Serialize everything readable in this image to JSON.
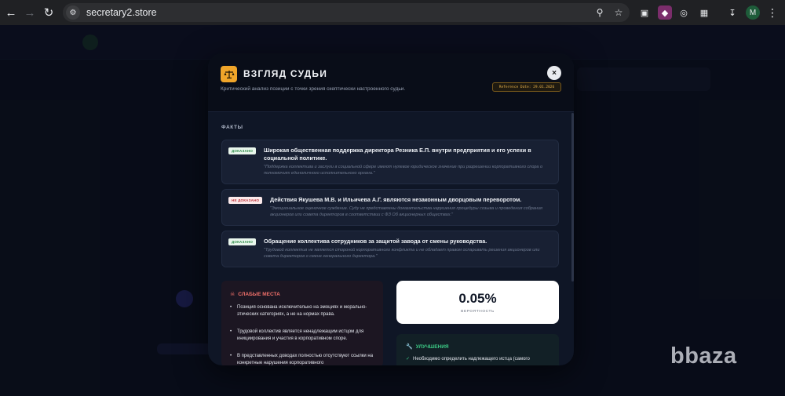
{
  "browser": {
    "url": "secretary2.store",
    "profile_initial": "M"
  },
  "modal": {
    "title": "ВЗГЛЯД СУДЬИ",
    "subtitle": "Критический анализ позиции с точки зрения скептически настроенного судьи.",
    "reference_date": "Reference Date: 29.01.2026",
    "close_label": "×",
    "facts_label": "ФАКТЫ",
    "facts": [
      {
        "status": "ДОКАЗАНО",
        "status_kind": "proven",
        "title": "Широкая общественная поддержка директора Резника Е.П. внутри предприятия и его успехи в социальной политике.",
        "note": "\"Поддержка коллектива и заслуги в социальной сфере имеют нулевое юридическое значение при разрешении корпоративного спора о полномочиях единоличного исполнительного органа.\""
      },
      {
        "status": "НЕ ДОКАЗАНО",
        "status_kind": "unproven",
        "title": "Действия Якушева М.В. и Ильичева А.Г. являются незаконным дворцовым переворотом.",
        "note": "\"Эмоциональное оценочное суждение. Суду не представлены доказательства нарушения процедуры созыва и проведения собрания акционеров или совета директоров в соответствии с ФЗ Об акционерных обществах.\""
      },
      {
        "status": "ДОКАЗАНО",
        "status_kind": "proven",
        "title": "Обращение коллектива сотрудников за защитой завода от смены руководства.",
        "note": "\"Трудовой коллектив не является стороной корпоративного конфликта и не обладает правом оспаривать решения акционеров или совета директоров о смене генерального директора.\""
      }
    ],
    "weak_points": {
      "title": "СЛАБЫЕ МЕСТА",
      "items": [
        "Позиция основана исключительно на эмоциях и морально-этических категориях, а не на нормах права.",
        "Трудовой коллектив является ненадлежащим истцом для инициирования и участия в корпоративном споре.",
        "В представленных доводах полностью отсутствуют ссылки на конкретные нарушения корпоративного"
      ]
    },
    "probability": {
      "value": "0.05%",
      "label": "ВЕРОЯТНОСТЬ"
    },
    "improvements": {
      "title": "УЛУЧШЕНИЯ",
      "items": [
        "Необходимо определить надлежащего истца (самого"
      ]
    }
  },
  "watermark": "bbaza",
  "colors": {
    "accent_gold": "#f0a52a",
    "proven": "#2b8a46",
    "unproven": "#c0383f",
    "weak": "#f0706a",
    "improve": "#3ccb86"
  }
}
